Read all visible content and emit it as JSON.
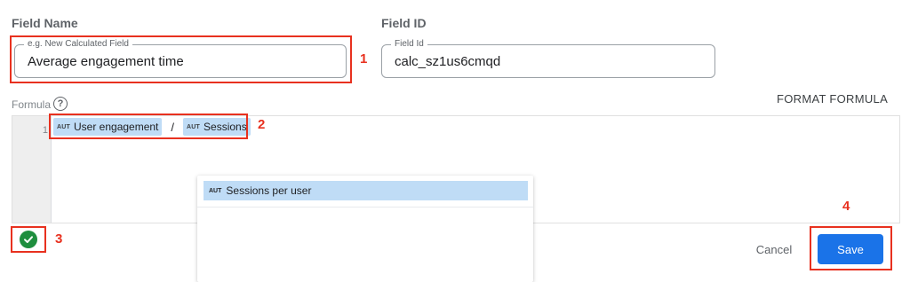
{
  "field_name": {
    "section_label": "Field Name",
    "legend": "e.g. New Calculated Field",
    "value": "Average engagement time"
  },
  "field_id": {
    "section_label": "Field ID",
    "legend": "Field Id",
    "value": "calc_sz1us6cmqd"
  },
  "formula": {
    "label": "Formula",
    "help_icon": "?",
    "format_button": "FORMAT FORMULA",
    "line_number": "1",
    "tokens": [
      {
        "type_tag": "AUT",
        "label": "User engagement"
      },
      {
        "operator": "/"
      },
      {
        "type_tag": "AUT",
        "label": "Sessions"
      }
    ],
    "operator": "/"
  },
  "autocomplete": {
    "items": [
      {
        "type_tag": "AUT",
        "label": "Sessions per user"
      }
    ]
  },
  "actions": {
    "cancel_label": "Cancel",
    "save_label": "Save"
  },
  "status": {
    "icon": "check-circle-icon",
    "valid_color": "#1e8e3e"
  },
  "annotations": {
    "labels": [
      "1",
      "2",
      "3",
      "4"
    ],
    "color": "#e8311f"
  },
  "colors": {
    "accent": "#1a73e8",
    "chip_bg": "#bfdcf6"
  }
}
